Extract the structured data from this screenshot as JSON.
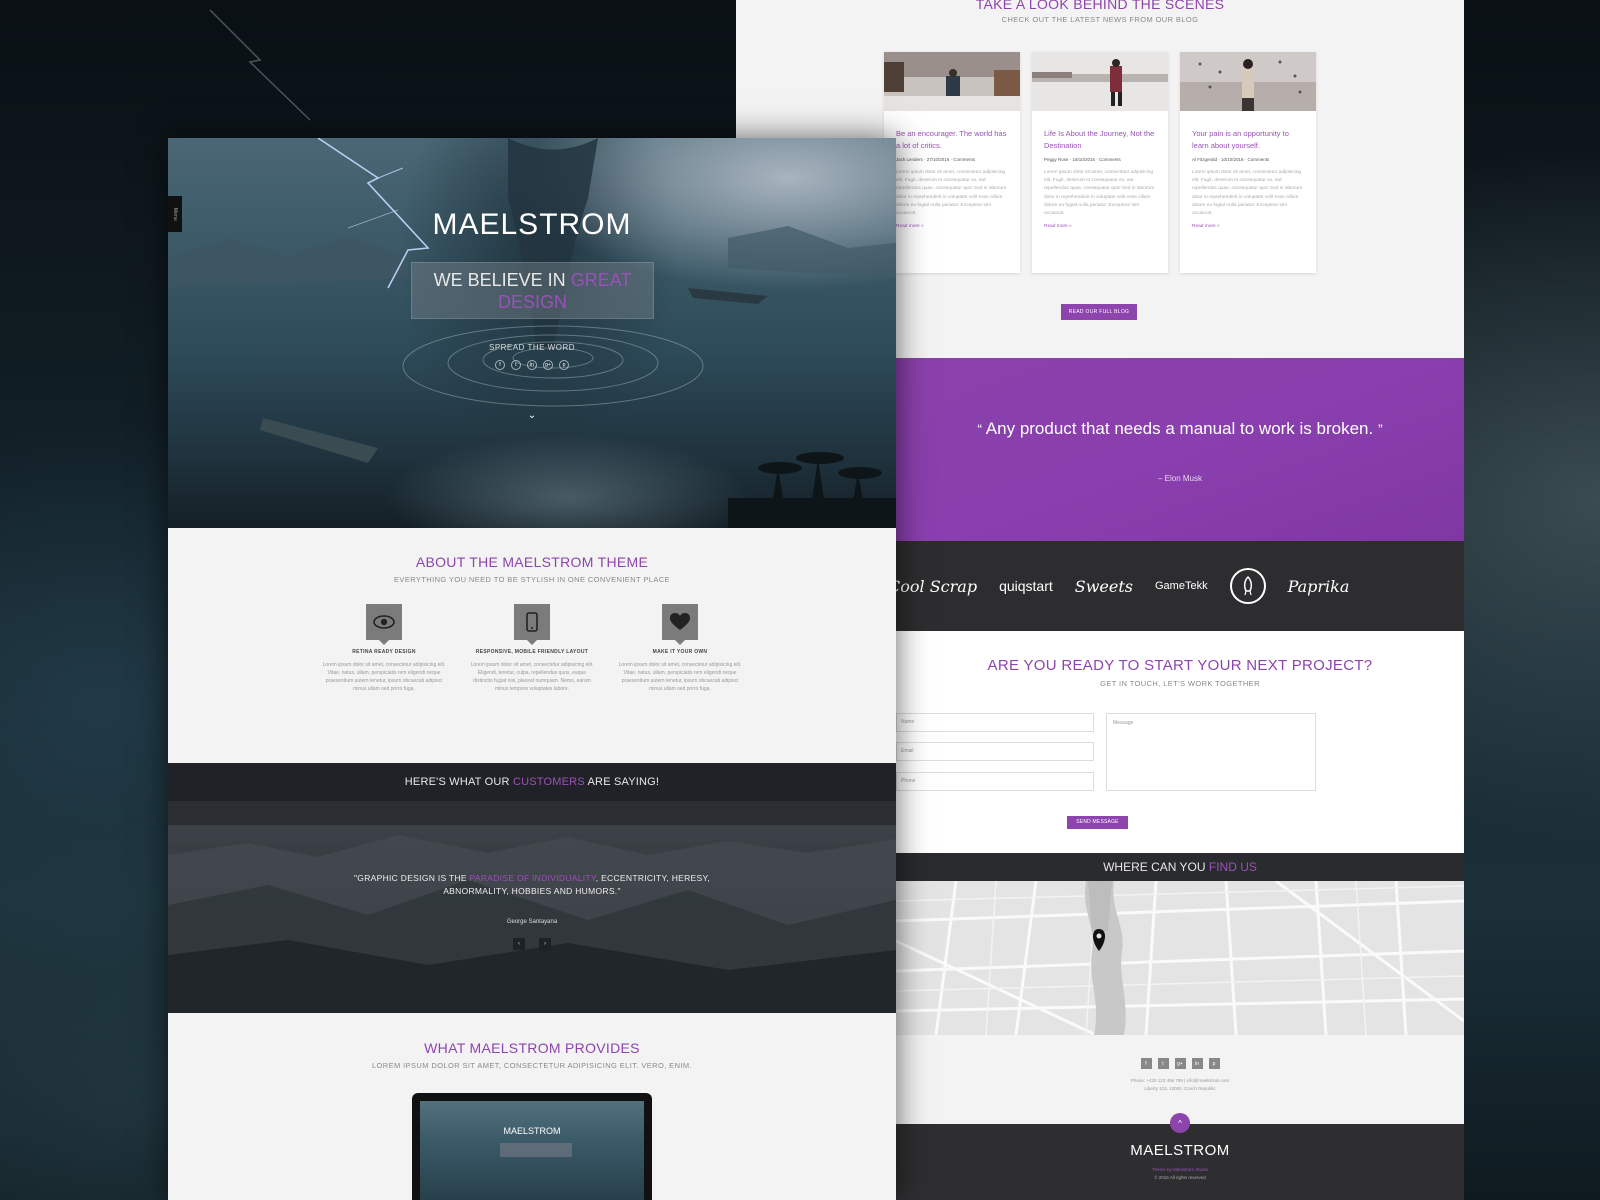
{
  "colors": {
    "accent": "#8e44ad",
    "dark": "#2d2d2f",
    "light": "#f3f3f3"
  },
  "hero": {
    "side_tab": "Menu",
    "title": "MAELSTROM",
    "tagline_prefix": "WE BELIEVE IN ",
    "tagline_highlight": "GREAT DESIGN",
    "spread": "SPREAD THE WORD",
    "socials": [
      "f",
      "t",
      "in",
      "g+",
      "p"
    ],
    "scroll_icon": "chevron-down-icon"
  },
  "about": {
    "title": "ABOUT THE MAELSTROM THEME",
    "subtitle": "EVERYTHING YOU NEED TO BE STYLISH IN ONE CONVENIENT PLACE",
    "features": [
      {
        "icon": "eye-icon",
        "title": "RETINA READY DESIGN",
        "text": "Lorem ipsum dolor sit amet, consectetur adipisicing elit. Vitae, natus, ullam, perspiciatis rem eligendi neque praesentium autem tenetur, ipsum obcaecati adipisci minus ullam sed porro fuga."
      },
      {
        "icon": "mobile-icon",
        "title": "RESPONSIVE, MOBILE FRIENDLY LAYOUT",
        "text": "Lorem ipsum dolor sit amet, consectetur adipisicing elit. Eligendi, tenetur, culpa, repellendus quos, eaque distinctio fugiat nisi, placeat numquam. Nemo, earum minus tempore voluptates labore."
      },
      {
        "icon": "heart-icon",
        "title": "MAKE IT YOUR OWN",
        "text": "Lorem ipsum dolor sit amet, consectetur adipisicing elit. Vitae, natus, ullam, perspiciatis rem eligendi neque praesentium autem tenetur, ipsum obcaecati adipisci minus ullam sed porro fuga."
      }
    ]
  },
  "customers": {
    "head_prefix": "HERE'S WHAT OUR ",
    "head_highlight": "CUSTOMERS",
    "head_suffix": " ARE SAYING!",
    "quote_prefix": "\"GRAPHIC DESIGN IS THE ",
    "quote_highlight": "PARADISE OF INDIVIDUALITY",
    "quote_suffix": ", ECCENTRICITY, HERESY, ABNORMALITY, HOBBIES AND HUMORS.\"",
    "author": "George Santayana",
    "prev": "‹",
    "next": "›"
  },
  "provides": {
    "title": "WHAT MAELSTROM PROVIDES",
    "subtitle": "LOREM IPSUM DOLOR SIT AMET, CONSECTETUR ADIPISICING ELIT. VERO, ENIM.",
    "laptop_title": "MAELSTROM"
  },
  "blog": {
    "title": "TAKE A LOOK BEHIND THE SCENES",
    "subtitle": "CHECK OUT THE LATEST NEWS FROM OUR BLOG",
    "posts": [
      {
        "title": "Be an encourager. The world has a lot of critics.",
        "meta": "Jack Lenders  ·  27/10/2016  ·  Comments",
        "text": "Lorem ipsum dolor sit amet, consectetur adipisicing elit. Fugit, deserunt et consequatur ex, aut repellendus quae, consequatur quo! Sed in laborum dolor in reprehenderit in voluptate velit esse cillum dolore eu fugiat nulla pariatur. Excepteur sint occaecat.",
        "more": "Read more »"
      },
      {
        "title": "Life Is About the Journey, Not the Destination",
        "meta": "Peggy Rose  ·  18/10/2016  ·  Comments",
        "text": "Lorem ipsum dolor sit amet, consectetur adipisicing elit. Fugit, deserunt et consequatur ex, aut repellendus quae, consequatur quo! Sed in laborum dolor in reprehenderit in voluptate velit esse cillum dolore eu fugiat nulla pariatur. Excepteur sint occaecat.",
        "more": "Read more »"
      },
      {
        "title": "Your pain is an opportunity to learn about yourself.",
        "meta": "Al Fitzgerald  ·  10/10/2016  ·  Comments",
        "text": "Lorem ipsum dolor sit amet, consectetur adipisicing elit. Fugit, deserunt et consequatur ex, aut repellendus quae, consequatur quo! Sed in laborum dolor in reprehenderit in voluptate velit esse cillum dolore eu fugiat nulla pariatur. Excepteur sint occaecat.",
        "more": "Read more »"
      }
    ],
    "button": "READ OUR FULL BLOG"
  },
  "quote_band": {
    "open": "“",
    "text": "Any product that needs a manual to work is broken.",
    "close": "”",
    "author": "– Elon Musk"
  },
  "logos": [
    "Cool Scrap",
    "quiqstart",
    "Sweets",
    "GameTekk",
    "Rocket",
    "Paprika"
  ],
  "contact": {
    "title": "ARE YOU READY TO START YOUR NEXT PROJECT?",
    "subtitle": "GET IN TOUCH, LET'S WORK TOGETHER",
    "fields": [
      "Name",
      "Email",
      "Phone"
    ],
    "message_placeholder": "Message",
    "send": "SEND MESSAGE"
  },
  "findus": {
    "head_prefix": "WHERE CAN YOU ",
    "head_highlight": "FIND US"
  },
  "footer": {
    "socials": [
      "f",
      "t",
      "g+",
      "in",
      "p"
    ],
    "contact_line1": "Phone: +420 123 456 789  |  info@maelstrom.com",
    "contact_line2": "Liberty 123, 12000, Czech Republic",
    "up": "^",
    "logo": "MAELSTROM",
    "credit": "Theme by Maelstrom Studio",
    "copyright": "© 2016 All rights reserved"
  }
}
